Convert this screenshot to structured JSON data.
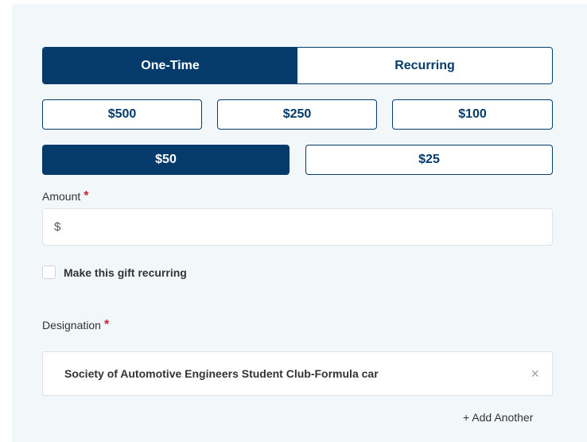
{
  "frequency": {
    "options": [
      "One-Time",
      "Recurring"
    ],
    "selected": "One-Time"
  },
  "amount_options": {
    "row1": [
      "$500",
      "$250",
      "$100"
    ],
    "row2": [
      "$50",
      "$25"
    ],
    "selected": "$50"
  },
  "amount": {
    "label": "Amount",
    "required_mark": "*",
    "prefix": "$",
    "value": ""
  },
  "recurring_checkbox": {
    "label": "Make this gift recurring",
    "checked": false
  },
  "designation": {
    "label": "Designation",
    "required_mark": "*",
    "selected": "Society of Automotive Engineers Student Club-Formula car",
    "remove_glyph": "×"
  },
  "add_another": "+ Add Another",
  "colors": {
    "primary": "#053b6b",
    "required": "#c4262e",
    "panel_bg": "#f2f8f9"
  }
}
